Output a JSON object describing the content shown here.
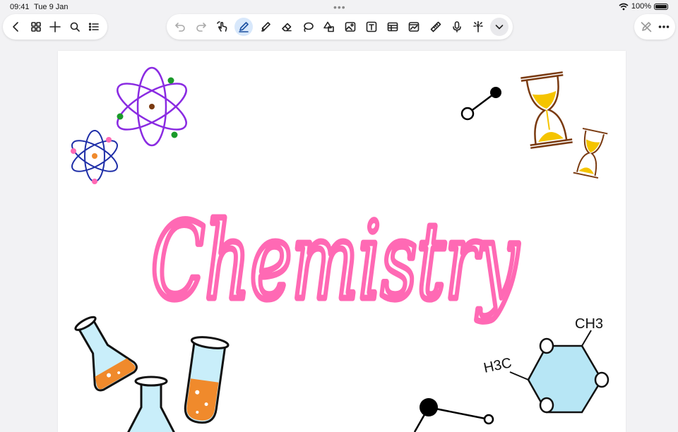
{
  "status": {
    "time": "09:41",
    "date": "Tue 9 Jan",
    "battery": "100%",
    "battery_level": 1.0
  },
  "toolbar": {
    "left": [
      {
        "name": "back-icon",
        "interactable": true
      },
      {
        "name": "grid-view-icon",
        "interactable": true
      },
      {
        "name": "add-icon",
        "interactable": true
      },
      {
        "name": "search-icon",
        "interactable": true
      },
      {
        "name": "outline-list-icon",
        "interactable": true
      }
    ],
    "center": [
      {
        "name": "undo-icon",
        "disabled": true
      },
      {
        "name": "redo-icon",
        "disabled": true
      },
      {
        "name": "hand-touch-icon"
      },
      {
        "name": "pen-icon",
        "active": true
      },
      {
        "name": "highlighter-icon"
      },
      {
        "name": "eraser-icon"
      },
      {
        "name": "lasso-icon"
      },
      {
        "name": "shapes-icon"
      },
      {
        "name": "image-icon"
      },
      {
        "name": "text-box-icon"
      },
      {
        "name": "table-icon"
      },
      {
        "name": "chart-icon"
      },
      {
        "name": "ruler-icon"
      },
      {
        "name": "microphone-icon"
      },
      {
        "name": "laser-pointer-icon"
      },
      {
        "name": "chevron-down-icon"
      }
    ],
    "right": [
      {
        "name": "read-only-pen-off-icon"
      },
      {
        "name": "more-options-icon"
      }
    ]
  },
  "note": {
    "title_handwritten": "Chemistry",
    "labels": {
      "ch3": "CH3",
      "h3c": "H3C"
    }
  },
  "colors": {
    "accent_blue": "#1a4fa0",
    "ink_pink": "#ff69b4",
    "atom_purple": "#8a2be2",
    "atom_blue": "#1f2fa8",
    "beaker_blue": "#c9eefa",
    "liquid_orange": "#f08a2c",
    "sand_yellow": "#f5c400",
    "ring_blue": "#b7e6f5"
  }
}
